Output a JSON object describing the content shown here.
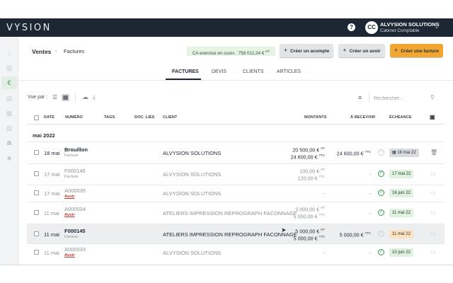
{
  "app": {
    "logo": "VYSION",
    "help": "?",
    "avatar_initials": "CC",
    "company": "ALVYSION SOLUTIONS",
    "company_sub": "Cabinet Comptable"
  },
  "breadcrumb": {
    "section": "Ventes",
    "page": "Factures"
  },
  "summary": {
    "ca_label": "CA exercice en cours : 758 012,24 €",
    "ca_unit": "HT"
  },
  "actions": {
    "acompte": "Créer un acompte",
    "avoir": "Créer un avoir",
    "facture": "Créer une facture"
  },
  "tabs": [
    "FACTURES",
    "DEVIS",
    "CLIENTS",
    "ARTICLES"
  ],
  "toolbar": {
    "view_label": "Vue par :",
    "search_placeholder": "Rechercher..."
  },
  "columns": {
    "date": "DATE",
    "numero": "NUMÉRO",
    "tags": "TAGS",
    "docs": "DOC. LIÉS",
    "client": "CLIENT",
    "montants": "MONTANTS",
    "recevoir": "À RECEVOIR",
    "echeance": "ÉCHÉANCE"
  },
  "group": "mai 2022",
  "rows": [
    {
      "date": "18 mai",
      "numero": "Brouillon",
      "type": "Facture",
      "client": "ALVYSION SOLUTIONS",
      "ht": "20 500,00 €",
      "ttc": "24 600,00 €",
      "recevoir": "24 600,00 €",
      "echeance": "18 mai 22"
    },
    {
      "date": "17 mai",
      "numero": "F000146",
      "type": "Facture",
      "client": "ALVYSION SOLUTIONS",
      "ht": "100,00 €",
      "ttc": "120,00 €",
      "recevoir": "-",
      "echeance": "17 mai 22"
    },
    {
      "date": "17 mai",
      "numero": "A000035",
      "type": "Avoir",
      "client": "ALVYSION SOLUTIONS",
      "ht": "-",
      "ttc": "",
      "recevoir": "-",
      "echeance": "16 juin 22"
    },
    {
      "date": "11 mai",
      "numero": "A000034",
      "type": "Avoir",
      "client": "ATELIERS IMPRESSION REPROGRAPH FACONNAGE",
      "ht": "5 000,00 €",
      "ttc": "5 000,00 €",
      "recevoir": "-",
      "echeance": "11 mai 22"
    },
    {
      "date": "11 mai",
      "numero": "F000145",
      "type": "Facture",
      "client": "ATELIERS IMPRESSION REPROGRAPH FACONNAGE",
      "ht": "5 000,00 €",
      "ttc": "5 000,00 €",
      "recevoir": "5 000,00 €",
      "echeance": "11 mai 22"
    },
    {
      "date": "11 mai",
      "numero": "A000033",
      "type": "Avoir",
      "client": "ALVYSION SOLUTIONS",
      "ht": "-",
      "ttc": "",
      "recevoir": "-",
      "echeance": "10 juin 22"
    }
  ],
  "units": {
    "ht": "HT",
    "ttc": "TTC"
  },
  "colors": {
    "topbar": "#1d2733",
    "accent_green": "#2e9a4a",
    "primary_orange": "#f2a632"
  }
}
